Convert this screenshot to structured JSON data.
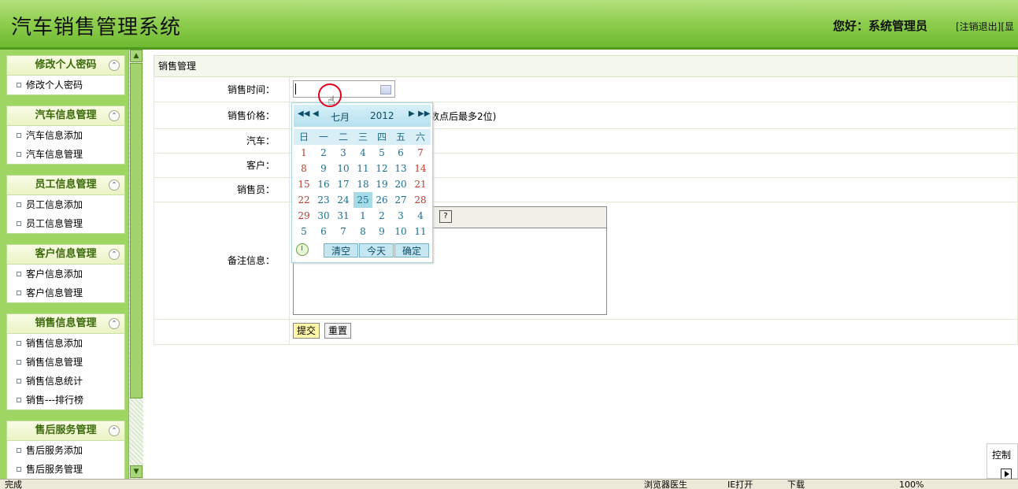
{
  "header": {
    "title": "汽车销售管理系统",
    "greeting": "您好：系统管理员",
    "logout_link": "[注销退出]",
    "extra_link": "[显"
  },
  "sidebar": {
    "groups": [
      {
        "title": "修改个人密码",
        "items": [
          "修改个人密码"
        ]
      },
      {
        "title": "汽车信息管理",
        "items": [
          "汽车信息添加",
          "汽车信息管理"
        ]
      },
      {
        "title": "员工信息管理",
        "items": [
          "员工信息添加",
          "员工信息管理"
        ]
      },
      {
        "title": "客户信息管理",
        "items": [
          "客户信息添加",
          "客户信息管理"
        ]
      },
      {
        "title": "销售信息管理",
        "items": [
          "销售信息添加",
          "销售信息管理",
          "销售信息统计",
          "销售---排行榜"
        ]
      },
      {
        "title": "售后服务管理",
        "items": [
          "售后服务添加",
          "售后服务管理"
        ]
      }
    ],
    "collapse_symbol": "⌃"
  },
  "form": {
    "section_title": "销售管理",
    "sale_time_label": "销售时间：",
    "sale_price_label": "销售价格：",
    "price_hint": "数点后最多2位)",
    "car_label": "汽车：",
    "customer_label": "客户：",
    "salesman_label": "销售员：",
    "remark_label": "备注信息：",
    "help_symbol": "?",
    "submit_label": "提交",
    "reset_label": "重置"
  },
  "calendar": {
    "nav_prev_year": "◀◀",
    "nav_prev_month": "◀",
    "nav_next_month": "▶",
    "nav_next_year": "▶▶",
    "month": "七月",
    "year": "2012",
    "weekdays": [
      "日",
      "一",
      "二",
      "三",
      "四",
      "五",
      "六"
    ],
    "weeks": [
      [
        "1",
        "2",
        "3",
        "4",
        "5",
        "6",
        "7"
      ],
      [
        "8",
        "9",
        "10",
        "11",
        "12",
        "13",
        "14"
      ],
      [
        "15",
        "16",
        "17",
        "18",
        "19",
        "20",
        "21"
      ],
      [
        "22",
        "23",
        "24",
        "25",
        "26",
        "27",
        "28"
      ],
      [
        "29",
        "30",
        "31",
        "1",
        "2",
        "3",
        "4"
      ],
      [
        "5",
        "6",
        "7",
        "8",
        "9",
        "10",
        "11"
      ]
    ],
    "selected_day": "25",
    "clear_label": "清空",
    "today_label": "今天",
    "ok_label": "确定"
  },
  "statusbar": {
    "status": "完成",
    "doctor": "浏览器医生",
    "ie_open": "IE打开",
    "download": "下载",
    "zoom": "100%"
  },
  "control_panel": {
    "label": "控制"
  },
  "colors": {
    "header_green": "#8fcf50",
    "sidebar_green": "#9ed563",
    "weekend_red": "#c0392b"
  }
}
